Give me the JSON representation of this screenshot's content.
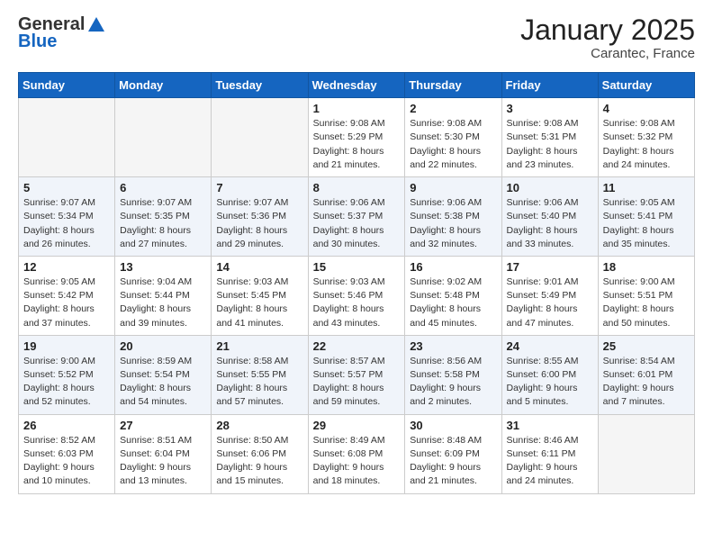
{
  "header": {
    "logo_general": "General",
    "logo_blue": "Blue",
    "month": "January 2025",
    "location": "Carantec, France"
  },
  "weekdays": [
    "Sunday",
    "Monday",
    "Tuesday",
    "Wednesday",
    "Thursday",
    "Friday",
    "Saturday"
  ],
  "weeks": [
    [
      {
        "day": "",
        "empty": true
      },
      {
        "day": "",
        "empty": true
      },
      {
        "day": "",
        "empty": true
      },
      {
        "day": "1",
        "sunrise": "9:08 AM",
        "sunset": "5:29 PM",
        "daylight": "8 hours and 21 minutes."
      },
      {
        "day": "2",
        "sunrise": "9:08 AM",
        "sunset": "5:30 PM",
        "daylight": "8 hours and 22 minutes."
      },
      {
        "day": "3",
        "sunrise": "9:08 AM",
        "sunset": "5:31 PM",
        "daylight": "8 hours and 23 minutes."
      },
      {
        "day": "4",
        "sunrise": "9:08 AM",
        "sunset": "5:32 PM",
        "daylight": "8 hours and 24 minutes."
      }
    ],
    [
      {
        "day": "5",
        "sunrise": "9:07 AM",
        "sunset": "5:34 PM",
        "daylight": "8 hours and 26 minutes."
      },
      {
        "day": "6",
        "sunrise": "9:07 AM",
        "sunset": "5:35 PM",
        "daylight": "8 hours and 27 minutes."
      },
      {
        "day": "7",
        "sunrise": "9:07 AM",
        "sunset": "5:36 PM",
        "daylight": "8 hours and 29 minutes."
      },
      {
        "day": "8",
        "sunrise": "9:06 AM",
        "sunset": "5:37 PM",
        "daylight": "8 hours and 30 minutes."
      },
      {
        "day": "9",
        "sunrise": "9:06 AM",
        "sunset": "5:38 PM",
        "daylight": "8 hours and 32 minutes."
      },
      {
        "day": "10",
        "sunrise": "9:06 AM",
        "sunset": "5:40 PM",
        "daylight": "8 hours and 33 minutes."
      },
      {
        "day": "11",
        "sunrise": "9:05 AM",
        "sunset": "5:41 PM",
        "daylight": "8 hours and 35 minutes."
      }
    ],
    [
      {
        "day": "12",
        "sunrise": "9:05 AM",
        "sunset": "5:42 PM",
        "daylight": "8 hours and 37 minutes."
      },
      {
        "day": "13",
        "sunrise": "9:04 AM",
        "sunset": "5:44 PM",
        "daylight": "8 hours and 39 minutes."
      },
      {
        "day": "14",
        "sunrise": "9:03 AM",
        "sunset": "5:45 PM",
        "daylight": "8 hours and 41 minutes."
      },
      {
        "day": "15",
        "sunrise": "9:03 AM",
        "sunset": "5:46 PM",
        "daylight": "8 hours and 43 minutes."
      },
      {
        "day": "16",
        "sunrise": "9:02 AM",
        "sunset": "5:48 PM",
        "daylight": "8 hours and 45 minutes."
      },
      {
        "day": "17",
        "sunrise": "9:01 AM",
        "sunset": "5:49 PM",
        "daylight": "8 hours and 47 minutes."
      },
      {
        "day": "18",
        "sunrise": "9:00 AM",
        "sunset": "5:51 PM",
        "daylight": "8 hours and 50 minutes."
      }
    ],
    [
      {
        "day": "19",
        "sunrise": "9:00 AM",
        "sunset": "5:52 PM",
        "daylight": "8 hours and 52 minutes."
      },
      {
        "day": "20",
        "sunrise": "8:59 AM",
        "sunset": "5:54 PM",
        "daylight": "8 hours and 54 minutes."
      },
      {
        "day": "21",
        "sunrise": "8:58 AM",
        "sunset": "5:55 PM",
        "daylight": "8 hours and 57 minutes."
      },
      {
        "day": "22",
        "sunrise": "8:57 AM",
        "sunset": "5:57 PM",
        "daylight": "8 hours and 59 minutes."
      },
      {
        "day": "23",
        "sunrise": "8:56 AM",
        "sunset": "5:58 PM",
        "daylight": "9 hours and 2 minutes."
      },
      {
        "day": "24",
        "sunrise": "8:55 AM",
        "sunset": "6:00 PM",
        "daylight": "9 hours and 5 minutes."
      },
      {
        "day": "25",
        "sunrise": "8:54 AM",
        "sunset": "6:01 PM",
        "daylight": "9 hours and 7 minutes."
      }
    ],
    [
      {
        "day": "26",
        "sunrise": "8:52 AM",
        "sunset": "6:03 PM",
        "daylight": "9 hours and 10 minutes."
      },
      {
        "day": "27",
        "sunrise": "8:51 AM",
        "sunset": "6:04 PM",
        "daylight": "9 hours and 13 minutes."
      },
      {
        "day": "28",
        "sunrise": "8:50 AM",
        "sunset": "6:06 PM",
        "daylight": "9 hours and 15 minutes."
      },
      {
        "day": "29",
        "sunrise": "8:49 AM",
        "sunset": "6:08 PM",
        "daylight": "9 hours and 18 minutes."
      },
      {
        "day": "30",
        "sunrise": "8:48 AM",
        "sunset": "6:09 PM",
        "daylight": "9 hours and 21 minutes."
      },
      {
        "day": "31",
        "sunrise": "8:46 AM",
        "sunset": "6:11 PM",
        "daylight": "9 hours and 24 minutes."
      },
      {
        "day": "",
        "empty": true
      }
    ]
  ]
}
